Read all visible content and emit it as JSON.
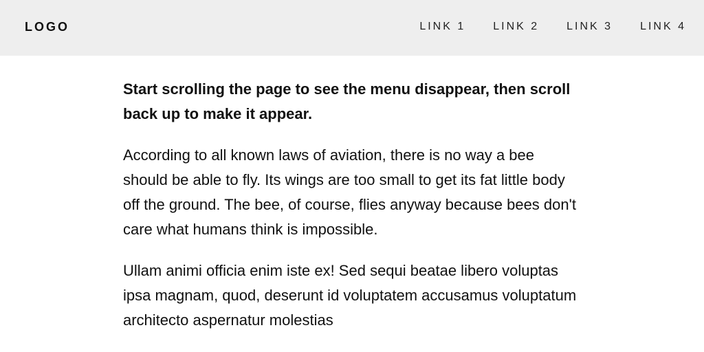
{
  "header": {
    "logo": "LOGO",
    "nav": [
      "LINK 1",
      "LINK 2",
      "LINK 3",
      "LINK 4"
    ]
  },
  "main": {
    "intro": "Start scrolling the page to see the menu disappear, then scroll back up to make it appear.",
    "paragraphs": [
      "According to all known laws of aviation, there is no way a bee should be able to fly. Its wings are too small to get its fat little body off the ground. The bee, of course, flies anyway because bees don't care what humans think is impossible.",
      "Ullam animi officia enim iste ex! Sed sequi beatae libero voluptas ipsa magnam, quod, deserunt id voluptatem accusamus voluptatum architecto aspernatur molestias"
    ]
  },
  "colors": {
    "header_bg": "#eeeeee",
    "page_bg": "#ffffff",
    "text": "#111111"
  }
}
